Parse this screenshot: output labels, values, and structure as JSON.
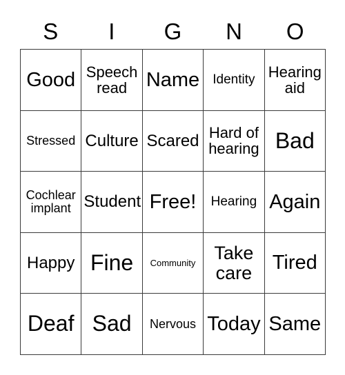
{
  "card": {
    "title_letters": [
      "S",
      "I",
      "G",
      "N",
      "O"
    ],
    "grid": {
      "rows": 5,
      "columns": 5,
      "border_color": "#3a3a3a",
      "background_color": "#ffffff",
      "text_color": "#000000"
    },
    "cells": [
      [
        {
          "label": "Good",
          "size": "xl"
        },
        {
          "label": "Speech\nread",
          "size": "m"
        },
        {
          "label": "Name",
          "size": "xl"
        },
        {
          "label": "Identity",
          "size": "sm"
        },
        {
          "label": "Hearing\naid",
          "size": "m"
        }
      ],
      [
        {
          "label": "Stressed",
          "size": "s"
        },
        {
          "label": "Culture",
          "size": "ml"
        },
        {
          "label": "Scared",
          "size": "ml"
        },
        {
          "label": "Hard of\nhearing",
          "size": "m"
        },
        {
          "label": "Bad",
          "size": "xxl"
        }
      ],
      [
        {
          "label": "Cochlear\nimplant",
          "size": "s"
        },
        {
          "label": "Student",
          "size": "ml"
        },
        {
          "label": "Free!",
          "size": "xl"
        },
        {
          "label": "Hearing",
          "size": "sm"
        },
        {
          "label": "Again",
          "size": "xl"
        }
      ],
      [
        {
          "label": "Happy",
          "size": "ml"
        },
        {
          "label": "Fine",
          "size": "xxl"
        },
        {
          "label": "Community",
          "size": "xs"
        },
        {
          "label": "Take\ncare",
          "size": "l"
        },
        {
          "label": "Tired",
          "size": "xl"
        }
      ],
      [
        {
          "label": "Deaf",
          "size": "xxl"
        },
        {
          "label": "Sad",
          "size": "xxl"
        },
        {
          "label": "Nervous",
          "size": "s"
        },
        {
          "label": "Today",
          "size": "xl"
        },
        {
          "label": "Same",
          "size": "xl"
        }
      ]
    ]
  }
}
